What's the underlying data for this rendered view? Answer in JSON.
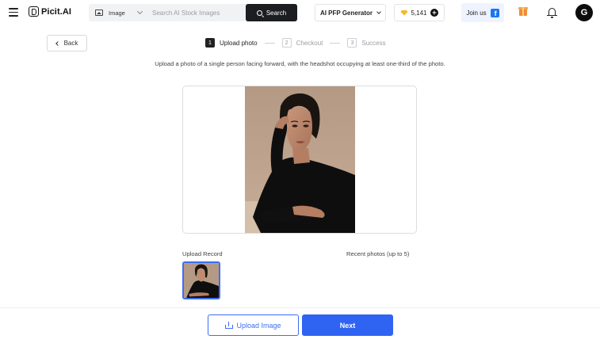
{
  "header": {
    "logo_text": "Picit.AI",
    "search": {
      "type_label": "Image",
      "placeholder": "Search AI Stock Images",
      "button_label": "Search"
    },
    "generator_label": "AI PFP Generator",
    "credits": "5,141",
    "join_label": "Join us",
    "avatar_letter": "G"
  },
  "nav": {
    "back_label": "Back",
    "steps": [
      {
        "num": "1",
        "label": "Upload photo",
        "active": true
      },
      {
        "num": "2",
        "label": "Checkout",
        "active": false
      },
      {
        "num": "3",
        "label": "Success",
        "active": false
      }
    ]
  },
  "main": {
    "instruction": "Upload a photo of a single person facing forward, with the headshot occupying at least one-third of the photo.",
    "upload_record_label": "Upload Record",
    "recent_label": "Recent photos (up to 5)"
  },
  "footer": {
    "upload_label": "Upload Image",
    "next_label": "Next"
  },
  "colors": {
    "accent": "#2f63f2",
    "dark": "#1c1d21",
    "gem": "#f5b82e",
    "facebook": "#1877f2"
  },
  "icons": [
    "menu-icon",
    "logo-icon",
    "image-icon",
    "search-icon",
    "chevron-down-icon",
    "gem-icon",
    "plus-icon",
    "facebook-icon",
    "gift-icon",
    "bell-icon",
    "chevron-left-icon",
    "upload-icon"
  ]
}
